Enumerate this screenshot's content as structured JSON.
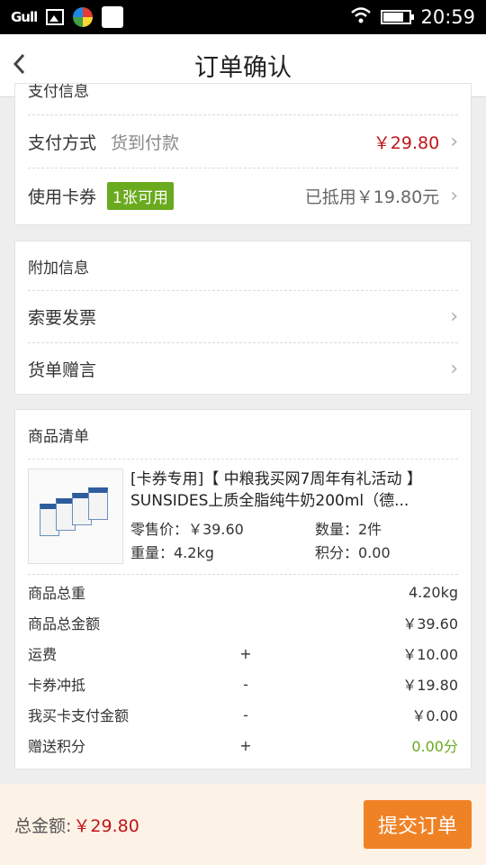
{
  "status_bar": {
    "signal": "Gull",
    "time": "20:59"
  },
  "header": {
    "back_icon": "chevron-left-icon",
    "title": "订单确认"
  },
  "payment_card": {
    "clipped_header": "支付信息",
    "payment_method_label": "支付方式",
    "payment_method_value": "货到付款",
    "payment_amount": "￥29.80",
    "coupon_label": "使用卡券",
    "coupon_badge": "1张可用",
    "coupon_value": "已抵用￥19.80元"
  },
  "extra_info": {
    "heading": "附加信息",
    "invoice_label": "索要发票",
    "message_label": "货单赠言"
  },
  "goods": {
    "heading": "商品清单",
    "product": {
      "name": "[卡券专用]【 中粮我买网7周年有礼活动 】SUNSIDES上质全脂纯牛奶200ml（德...",
      "retail_price": "零售价：￥39.60",
      "quantity": "数量：2件",
      "weight": "重量：4.2kg",
      "points": "积分：0.00"
    },
    "summary": [
      {
        "label": "商品总重",
        "op": "",
        "value": "4.20kg"
      },
      {
        "label": "商品总金额",
        "op": "",
        "value": "￥39.60"
      },
      {
        "label": "运费",
        "op": "+",
        "value": "￥10.00"
      },
      {
        "label": "卡券冲抵",
        "op": "-",
        "value": "￥19.80"
      },
      {
        "label": "我买卡支付金额",
        "op": "-",
        "value": "￥0.00"
      },
      {
        "label": "赠送积分",
        "op": "+",
        "value": "0.00分"
      }
    ]
  },
  "footer": {
    "total_label": "总金额:",
    "total_value": "￥29.80",
    "submit_label": "提交订单"
  },
  "colors": {
    "accent_orange": "#f08226",
    "price_red": "#c0141b",
    "badge_green": "#6aaa1e"
  }
}
